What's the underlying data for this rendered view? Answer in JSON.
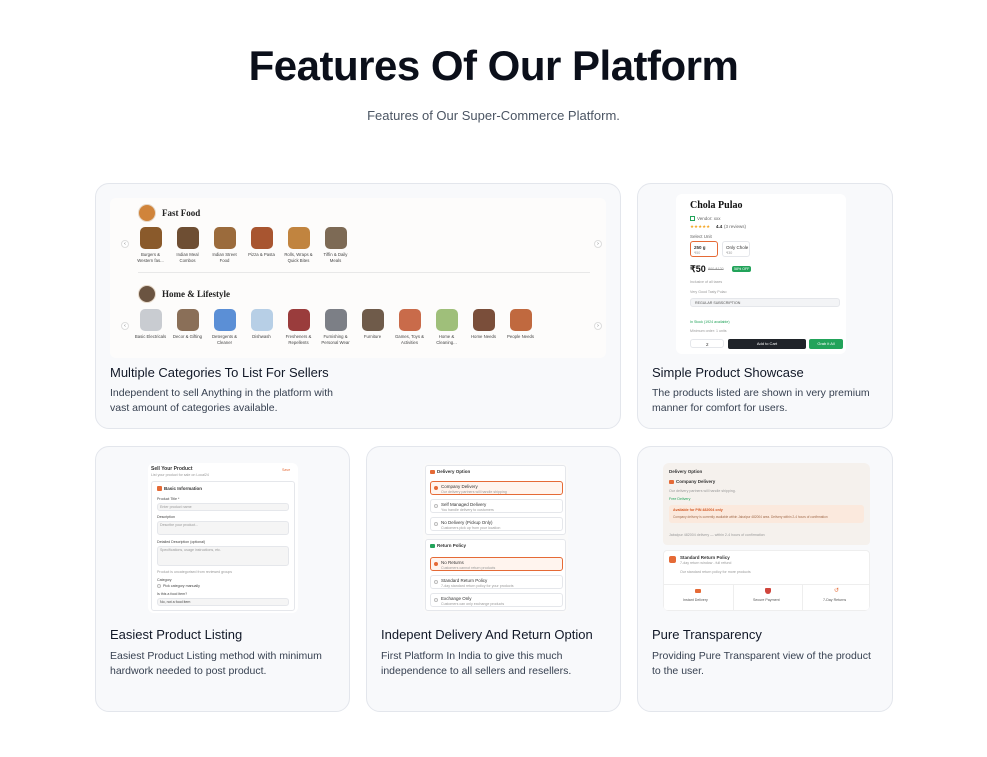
{
  "header": {
    "title": "Features Of Our Platform",
    "subtitle": "Features of Our Super-Commerce Platform."
  },
  "cards": [
    {
      "title": "Multiple Categories To List For Sellers",
      "desc1": "Independent to sell Anything in the platform with",
      "desc2": "vast amount of categories available."
    },
    {
      "title": "Simple Product Showcase",
      "desc1": "The products listed are shown in very premium",
      "desc2": "manner for comfort for users."
    },
    {
      "title": "Easiest Product Listing",
      "desc1": "Easiest Product Listing method with minimum",
      "desc2": "hardwork needed to post product."
    },
    {
      "title": "Indepent Delivery And Return Option",
      "desc1": "First Platform In India to give this much",
      "desc2": "independence to all sellers and resellers."
    },
    {
      "title": "Pure Transparency",
      "desc1": "Providing Pure Transparent view of the product",
      "desc2": "to the user."
    }
  ],
  "categories": {
    "food_title": "Fast Food",
    "food_items": [
      "Burgers & Western fas...",
      "Indian Meal Combos",
      "Indian Street Food",
      "Pizza & Pasta",
      "Rolls, Wraps & Quick Bites",
      "Tiffin & Daily Meals"
    ],
    "home_title": "Home & Lifestyle",
    "home_items": [
      "Basic Electricals",
      "Decor & Gifting",
      "Detergents & Cleaner",
      "Dishwash",
      "Fresheners & Repellents",
      "Furnishing & Personal Wear",
      "Furniture",
      "Games, Toys & Activities",
      "Home & Cleaning...",
      "Home Needs",
      "People Needs"
    ]
  },
  "product": {
    "name": "Chola Pulao",
    "seller": "Vendor: xxx",
    "rating": "4.4",
    "reviews": "(3 reviews)",
    "select_unit": "Select Unit",
    "unit1": "250 g",
    "unit1_price": "₹50",
    "unit2": "Only Chole",
    "unit2_price": "₹30",
    "price": "₹50",
    "old_price": "₹60 ₹120",
    "discount": "58% OFF",
    "tax": "Inclusive of all taxes",
    "note": "Very Good Tasty Pulao",
    "variant": "REGULAR SUBSCRIPTION",
    "stock": "In Stock (1924 available)",
    "min_order": "Minimum order: 1 units",
    "qty": "2",
    "add_to_cart": "Add to Cart",
    "buy_now": "Grab it All"
  },
  "listing": {
    "title": "Sell Your Product",
    "subtitle": "List your product for sale on Local24",
    "save": "Save",
    "section": "Basic Information",
    "f1": "Product Title *",
    "f1_ph": "Enter product name",
    "f2": "Description",
    "f2_ph": "Describe your product...",
    "f3": "Detailed Description (optional)",
    "f3_ph": "Specifications, usage instructions, etc.",
    "f3_note": "Product is uncategorised from reviewed groups",
    "f4": "Category",
    "f4_val": "Pick category manually",
    "f5": "Is this a food item?",
    "f5_val": "No, not a food item"
  },
  "delivery": {
    "title": "Delivery Option",
    "opt1": "Company Delivery",
    "opt1_sub": "Our delivery partners will handle shipping",
    "opt2": "Self Managed Delivery",
    "opt2_sub": "You handle delivery to customers",
    "opt3": "No Delivery (Pickup Only)",
    "opt3_sub": "Customers pick up from your location",
    "return_title": "Return Policy",
    "r1": "No Returns",
    "r1_sub": "Customers cannot return products",
    "r2": "Standard Return Policy",
    "r2_sub": "7-day standard return policy for your products",
    "r3": "Exchange Only",
    "r3_sub": "Customers can only exchange products"
  },
  "transparency": {
    "title": "Delivery Option",
    "company": "Company Delivery",
    "company_sub": "Our delivery partners will handle shipping.",
    "free": "Free Delivery",
    "avail": "Available for PIN 482004 only",
    "avail_sub": "Company delivery is currently available within Jabalpur 482004 area. Delivery within 2-4 hours of confirmation",
    "eta": "Jabalpur 482004 delivery — within 2-4 hours of confirmation",
    "policy": "Standard Return Policy",
    "policy_sub": "7-day return window - full refund",
    "policy_note": "Our standard return policy for more products",
    "b1": "Instant Delivery",
    "b2": "Secure Payment",
    "b3": "7-Day Returns"
  },
  "colors": {
    "accent": "#e56a36",
    "green": "#22a35a",
    "dark": "#1f2329"
  }
}
